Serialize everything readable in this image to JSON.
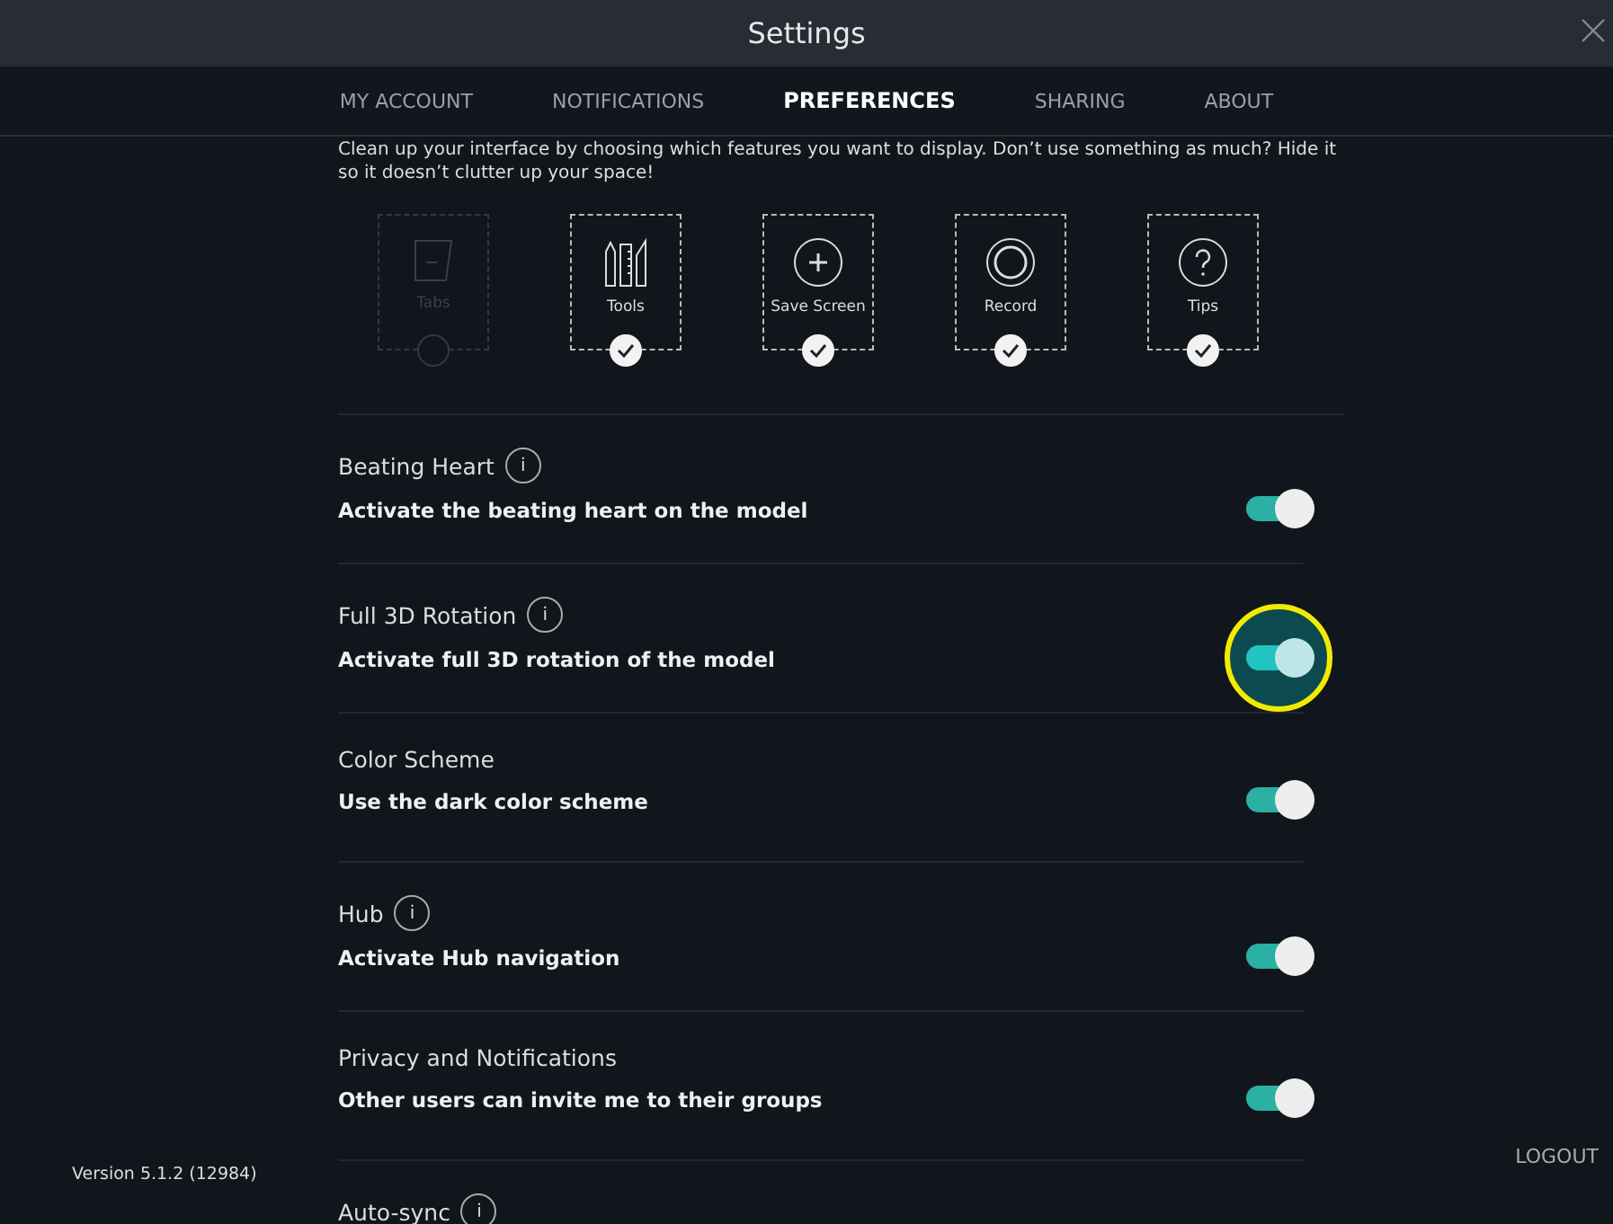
{
  "window": {
    "title": "Settings"
  },
  "tabs": [
    {
      "label": "MY ACCOUNT",
      "selected": false
    },
    {
      "label": "NOTIFICATIONS",
      "selected": false
    },
    {
      "label": "PREFERENCES",
      "selected": true
    },
    {
      "label": "SHARING",
      "selected": false
    },
    {
      "label": "ABOUT",
      "selected": false
    }
  ],
  "intro": "Clean up your interface by choosing which features you want to display. Don’t use something as much? Hide it so it doesn’t clutter up your space!",
  "features": [
    {
      "kind": "tabs",
      "label": "Tabs",
      "checked": false
    },
    {
      "kind": "tools",
      "label": "Tools",
      "checked": true
    },
    {
      "kind": "save",
      "label": "Save Screen",
      "checked": true
    },
    {
      "kind": "record",
      "label": "Record",
      "checked": true
    },
    {
      "kind": "tips",
      "label": "Tips",
      "checked": true
    }
  ],
  "settings": [
    {
      "title": "Beating Heart",
      "info": "i",
      "description": "Activate the beating heart on the model",
      "on": true,
      "highlighted": false
    },
    {
      "title": "Full 3D Rotation",
      "info": "i",
      "description": "Activate full 3D rotation of the model",
      "on": true,
      "highlighted": true
    },
    {
      "title": "Color Scheme",
      "description": "Use the dark color scheme",
      "on": true,
      "highlighted": false
    },
    {
      "title": "Hub",
      "info": "i",
      "description": "Activate Hub navigation",
      "on": true,
      "highlighted": false
    },
    {
      "title": "Privacy and Notifications",
      "description": "Other users can invite me to their groups",
      "on": true,
      "highlighted": false
    },
    {
      "title": "Auto-sync",
      "info": "i"
    }
  ],
  "version": "Version 5.1.2 (12984)",
  "logout": "LOGOUT"
}
